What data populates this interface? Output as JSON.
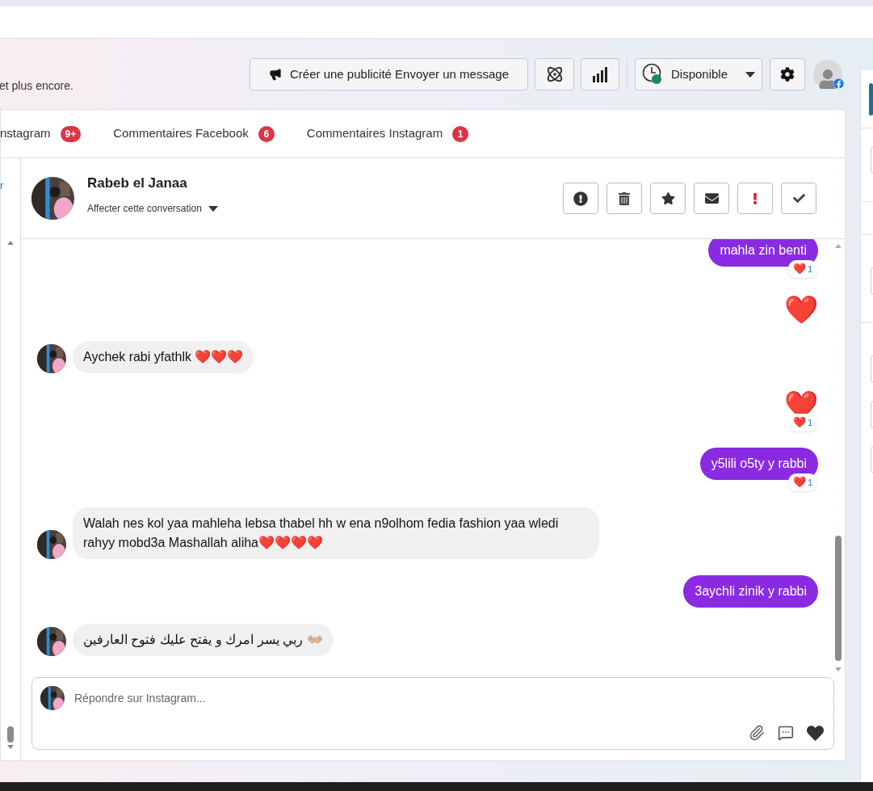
{
  "banner": {
    "text": "et plus encore."
  },
  "toolbar": {
    "ad_button": "Créer une publicité Envoyer un message",
    "status": "Disponible"
  },
  "tabs": [
    {
      "label": "nstagram",
      "badge": "9+",
      "selected": false
    },
    {
      "label": "Commentaires Facebook",
      "badge": "6",
      "selected": false
    },
    {
      "label": "Commentaires Instagram",
      "badge": "1",
      "selected": false
    }
  ],
  "sidebar_fragment": "r",
  "conversation": {
    "name": "Rabeb el Janaa",
    "assign": "Affecter cette conversation"
  },
  "messages": [
    {
      "kind": "outgoing",
      "text": "mahla zin benti",
      "reaction": {
        "emoji": "❤️",
        "count": "1"
      }
    },
    {
      "kind": "outgoing_emoji",
      "text": "❤️"
    },
    {
      "kind": "incoming",
      "text": "Aychek rabi yfathlk ❤️❤️❤️"
    },
    {
      "kind": "outgoing_emoji",
      "text": "❤️",
      "reaction": {
        "emoji": "❤️",
        "count": "1"
      }
    },
    {
      "kind": "outgoing",
      "text": "y5lili o5ty y rabbi",
      "reaction": {
        "emoji": "❤️",
        "count": "1"
      }
    },
    {
      "kind": "incoming",
      "text": "Walah nes kol yaa mahleha lebsa thabel hh w ena n9olhom fedia fashion yaa wledi rahyy mobd3a Mashallah aliha❤️❤️❤️❤️"
    },
    {
      "kind": "outgoing",
      "text": "3aychli zinik y rabbi"
    },
    {
      "kind": "incoming",
      "text": "ربي يسر امرك و يفتح عليك فتوح العارفين 👐🏼"
    }
  ],
  "composer": {
    "placeholder": "Répondre sur Instagram..."
  },
  "right_panel": [
    {
      "kind": "field"
    },
    {
      "kind": "divider"
    },
    {
      "kind": "divider"
    },
    {
      "kind": "field"
    },
    {
      "kind": "divider"
    },
    {
      "kind": "field"
    },
    {
      "kind": "field"
    },
    {
      "kind": "field"
    }
  ]
}
